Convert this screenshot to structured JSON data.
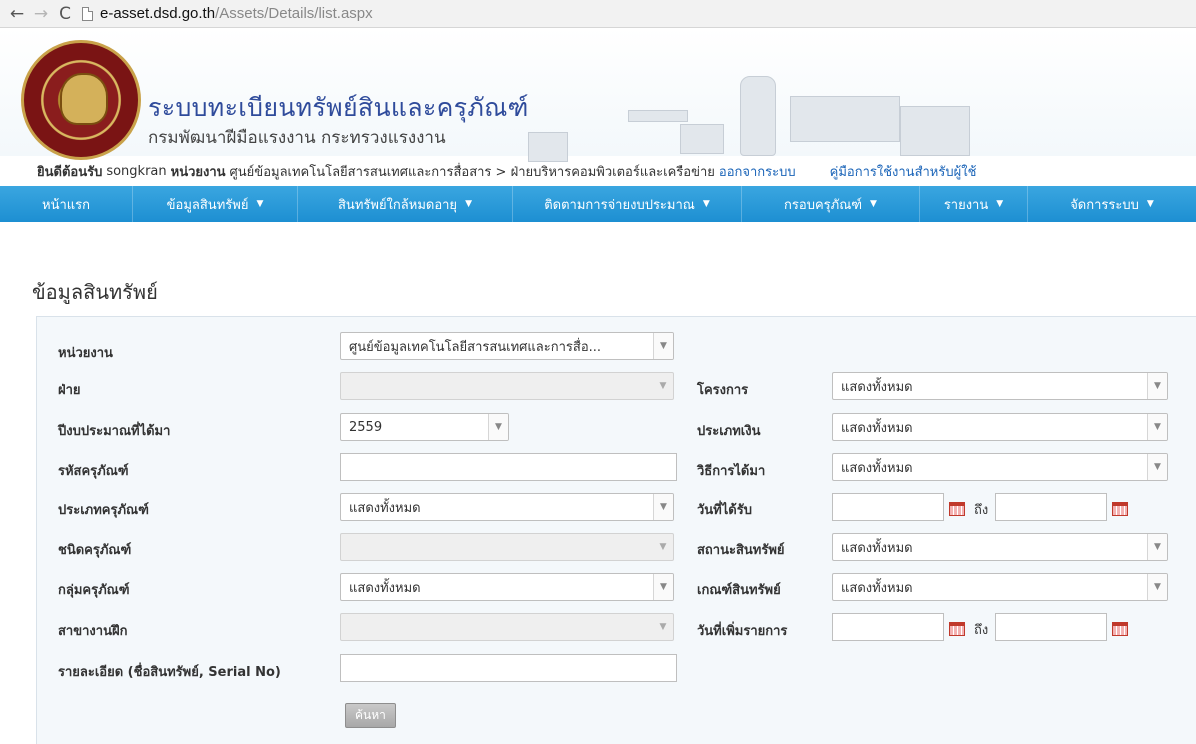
{
  "browser": {
    "back": "←",
    "forward": "→",
    "reload": "C",
    "url_domain": "e-asset.dsd.go.th",
    "url_path": "/Assets/Details/list.aspx"
  },
  "banner": {
    "title": "ระบบทะเบียนทรัพย์สินและครุภัณฑ์",
    "subtitle": "กรมพัฒนาฝีมือแรงงาน กระทรวงแรงงาน"
  },
  "welcome": {
    "greeting": "ยินดีต้อนรับ",
    "user": "songkran",
    "unit_label": "หน่วยงาน",
    "unit_value": "ศูนย์ข้อมูลเทคโนโลยีสารสนเทศและการสื่อสาร > ฝ่ายบริหารคอมพิวเตอร์และเครือข่าย",
    "logout": "ออกจากระบบ",
    "manual": "คู่มือการใช้งานสำหรับผู้ใช้"
  },
  "menu": {
    "items": [
      {
        "label": "หน้าแรก",
        "caret": ""
      },
      {
        "label": "ข้อมูลสินทรัพย์",
        "caret": "▼"
      },
      {
        "label": "สินทรัพย์ใกล้หมดอายุ",
        "caret": "▼"
      },
      {
        "label": "ติดตามการจ่ายงบประมาณ",
        "caret": "▼"
      },
      {
        "label": "กรอบครุภัณฑ์",
        "caret": "▼"
      },
      {
        "label": "รายงาน",
        "caret": "▼"
      },
      {
        "label": "จัดการระบบ",
        "caret": "▼"
      }
    ]
  },
  "page": {
    "title": "ข้อมูลสินทรัพย์"
  },
  "form": {
    "unit_label": "หน่วยงาน",
    "unit_value": "ศูนย์ข้อมูลเทคโนโลยีสารสนเทศและการสื่อ...",
    "division_label": "ฝ่าย",
    "division_value": "",
    "project_label": "โครงการ",
    "project_value": "แสดงทั้งหมด",
    "fiscal_year_label": "ปีงบประมาณที่ได้มา",
    "fiscal_year_value": "2559",
    "money_type_label": "ประเภทเงิน",
    "money_type_value": "แสดงทั้งหมด",
    "equipment_code_label": "รหัสครุภัณฑ์",
    "equipment_code_value": "",
    "acquire_method_label": "วิธีการได้มา",
    "acquire_method_value": "แสดงทั้งหมด",
    "equipment_type_label": "ประเภทครุภัณฑ์",
    "equipment_type_value": "แสดงทั้งหมด",
    "received_date_label": "วันที่ได้รับ",
    "to_label": "ถึง",
    "equipment_kind_label": "ชนิดครุภัณฑ์",
    "equipment_kind_value": "",
    "asset_status_label": "สถานะสินทรัพย์",
    "asset_status_value": "แสดงทั้งหมด",
    "equipment_group_label": "กลุ่มครุภัณฑ์",
    "equipment_group_value": "แสดงทั้งหมด",
    "asset_criteria_label": "เกณฑ์สินทรัพย์",
    "asset_criteria_value": "แสดงทั้งหมด",
    "training_branch_label": "สาขางานฝึก",
    "training_branch_value": "",
    "added_date_label": "วันที่เพิ่มรายการ",
    "details_label": "รายละเอียด (ชื่อสินทรัพย์, Serial No)",
    "details_value": "",
    "search_button": "ค้นหา"
  },
  "colors": {
    "menu_bg": "#1d8fd2",
    "title_blue": "#2f4b9b",
    "link": "#1a64b8"
  }
}
